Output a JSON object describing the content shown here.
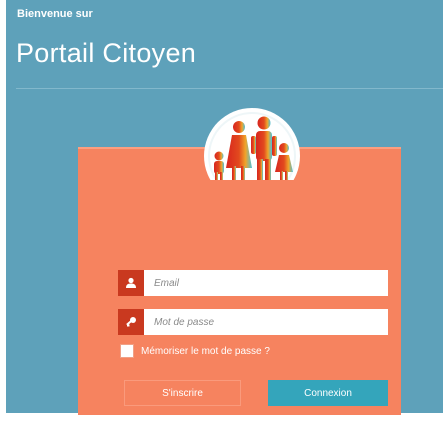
{
  "header": {
    "welcome": "Bienvenue sur",
    "title": "Portail Citoyen"
  },
  "login": {
    "email_placeholder": "Email",
    "password_placeholder": "Mot de passe",
    "remember_label": "Mémoriser le mot de passe ?",
    "register_label": "S'inscrire",
    "login_label": "Connexion"
  },
  "icons": {
    "email": "user-icon",
    "password": "key-icon",
    "logo": "family-logo"
  },
  "colors": {
    "background": "#5ea1ba",
    "card": "#f6835f",
    "icon_box": "#c9391f",
    "primary_button": "#34a5bb"
  }
}
